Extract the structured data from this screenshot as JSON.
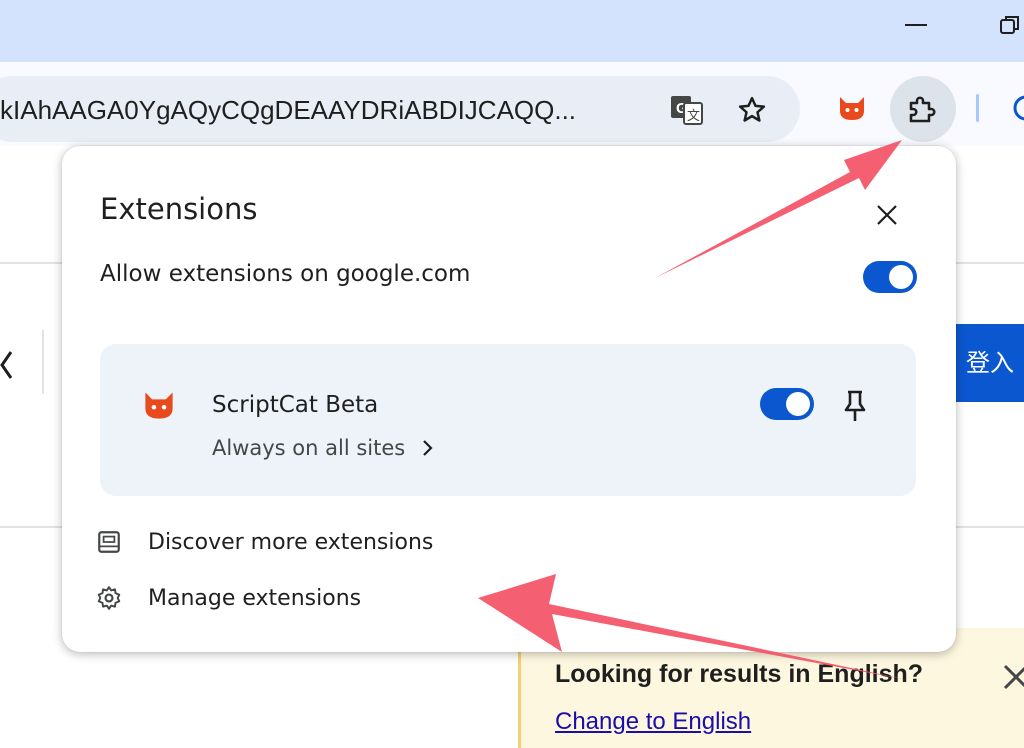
{
  "browser": {
    "url_text": "kIAhAAGA0YgAQyCQgDEAAYDRiABDIJCAQQ...",
    "icons": [
      "translate-icon",
      "star-icon",
      "scriptcat-icon",
      "puzzle-icon",
      "minimize-icon",
      "restore-icon"
    ],
    "accent_color": "#0b57d0"
  },
  "page": {
    "signin_label": "登入",
    "language_banner": {
      "title": "Looking for results in English?",
      "link": "Change to English"
    }
  },
  "extensions_popup": {
    "title": "Extensions",
    "allow_label": "Allow extensions on google.com",
    "allow_enabled": true,
    "extension": {
      "name": "ScriptCat Beta",
      "site_access": "Always on all sites",
      "enabled": true,
      "icon": "scriptcat-icon"
    },
    "menu": [
      {
        "label": "Discover more extensions",
        "icon": "webstore-icon"
      },
      {
        "label": "Manage extensions",
        "icon": "gear-icon"
      }
    ]
  },
  "annotations": {
    "arrow_color": "#f4566a"
  }
}
